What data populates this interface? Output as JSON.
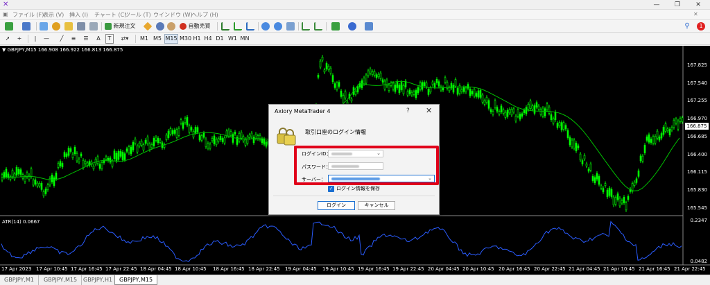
{
  "menu": [
    "ファイル (F)",
    "表示 (V)",
    "挿入 (I)",
    "チャート (C)",
    "ツール (T)",
    "ウインドウ (W)",
    "ヘルプ (H)"
  ],
  "toolbar1": {
    "new_order_label": "新規注文",
    "auto_trade_label": "自動売買"
  },
  "timeframes": [
    "M1",
    "M5",
    "M15",
    "M30",
    "H1",
    "H4",
    "D1",
    "W1",
    "MN"
  ],
  "notification_count": "1",
  "chart": {
    "info": "▼ GBPJPY,M15  166.908 166.922 166.813 166.875",
    "price_labels": [
      "167.825",
      "167.540",
      "167.255",
      "166.970",
      "166.685",
      "166.400",
      "166.115",
      "165.830",
      "165.545"
    ],
    "current_price": "166.875",
    "atr_info": "ATR(14) 0.0667",
    "atr_labels": [
      "0.2347",
      "0.0482"
    ],
    "time_labels": [
      "17 Apr 2023",
      "17 Apr 10:45",
      "17 Apr 16:45",
      "17 Apr 22:45",
      "18 Apr 04:45",
      "18 Apr 10:45",
      "18 Apr 16:45",
      "18 Apr 22:45",
      "19 Apr 04:45",
      "19 Apr 10:45",
      "19 Apr 16:45",
      "19 Apr 22:45",
      "20 Apr 04:45",
      "20 Apr 10:45",
      "20 Apr 16:45",
      "20 Apr 22:45",
      "21 Apr 04:45",
      "21 Apr 10:45",
      "21 Apr 16:45",
      "21 Apr 22:45"
    ],
    "candle_color": "#00ff00",
    "ma_color": "#00c000",
    "atr_color": "#2a5cff"
  },
  "tabs": [
    "GBPJPY,M1",
    "GBPJPY,M15",
    "GBPJPY,H1",
    "GBPJPY,M15"
  ],
  "active_tab": 3,
  "dialog": {
    "title": "Axiory MetaTrader 4",
    "help": "?",
    "close": "✕",
    "heading": "取引口座のログイン情報",
    "login_label": "ログインID：",
    "password_label": "パスワード：",
    "server_label": "サーバー：",
    "save_label": "ログイン情報を保存",
    "login_button": "ログイン",
    "cancel_button": "キャンセル"
  },
  "highlight_color": "#e0001a"
}
